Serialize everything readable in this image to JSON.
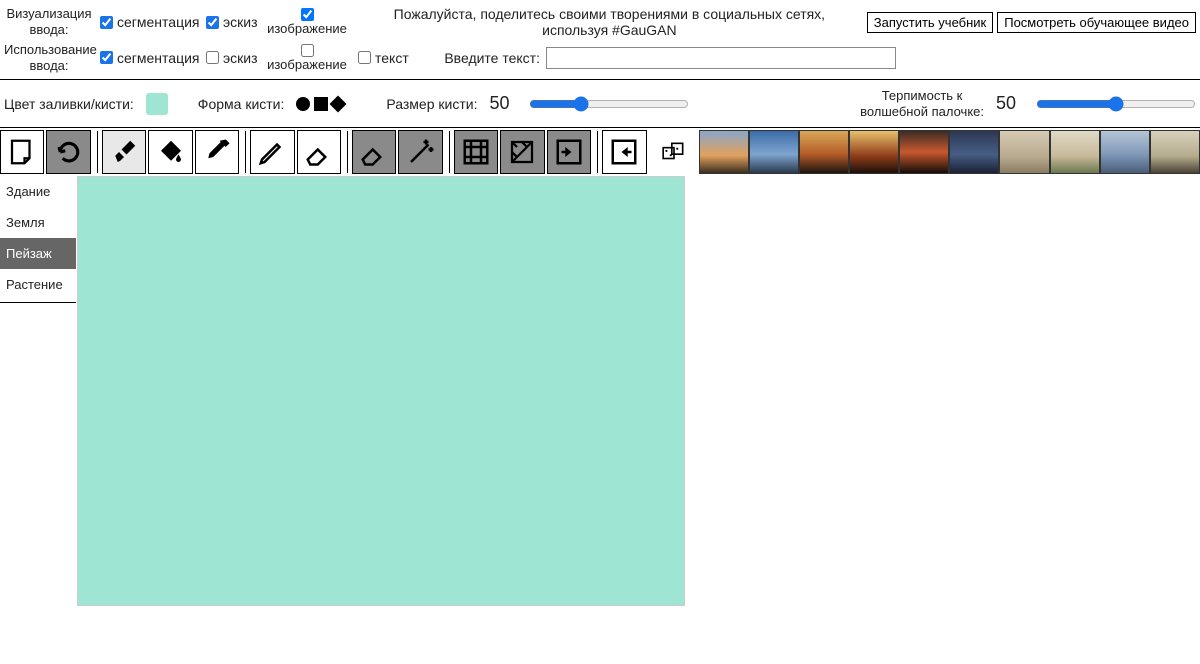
{
  "row1": {
    "vis_label": "Визуализация ввода:",
    "seg": "сегментация",
    "sketch": "эскиз",
    "image": "изображение",
    "share_msg": "Пожалуйста, поделитесь своими творениями в социальных сетях, используя #GauGAN",
    "btn_tutorial": "Запустить учебник",
    "btn_video": "Посмотреть обучающее видео"
  },
  "row2": {
    "use_label": "Использование ввода:",
    "seg": "сегментация",
    "sketch": "эскиз",
    "image": "изображение",
    "text": "текст",
    "enter_text": "Введите текст:",
    "text_value": ""
  },
  "row3": {
    "fill_label": "Цвет заливки/кисти:",
    "shape_label": "Форма кисти:",
    "size_label": "Размер кисти:",
    "size_value": "50",
    "tolerance_label_1": "Терпимость к",
    "tolerance_label_2": "волшебной палочке:",
    "tolerance_value": "50"
  },
  "sidebar": {
    "items": [
      "Здание",
      "Земля",
      "Пейзаж",
      "Растение"
    ],
    "active_index": 2
  },
  "thumbs": [
    {
      "bg": "linear-gradient(to bottom,#8aa6c9 0%,#e2a15e 58%,#3b2e1e 100%)"
    },
    {
      "bg": "linear-gradient(to bottom,#3b6ca8 0%,#7fa5cf 55%,#2a3a4e 100%)"
    },
    {
      "bg": "linear-gradient(to bottom,#d6a858 0%,#b55b27 55%,#1e1510 100%)"
    },
    {
      "bg": "linear-gradient(to bottom,#e7c06b 0%,#8e3c19 60%,#1b0f0a 100%)"
    },
    {
      "bg": "linear-gradient(to bottom,#3a2c24 0%,#c9582e 50%,#170d09 100%)"
    },
    {
      "bg": "linear-gradient(to bottom,#2c3752 0%,#475d85 55%,#1a2235 100%)"
    },
    {
      "bg": "linear-gradient(to bottom,#d6cab5 0%,#b9ab8f 60%,#8a7c62 100%)"
    },
    {
      "bg": "linear-gradient(to bottom,#dedac5 0%,#c8b89a 60%,#6a7950 100%)"
    },
    {
      "bg": "linear-gradient(to bottom,#b6c5d6 0%,#7f99b9 55%,#4a5d78 100%)"
    },
    {
      "bg": "linear-gradient(to bottom,#d7d1bb 0%,#b5ac8d 60%,#494236 100%)"
    }
  ],
  "colors": {
    "canvas": "#9ee5d4"
  }
}
